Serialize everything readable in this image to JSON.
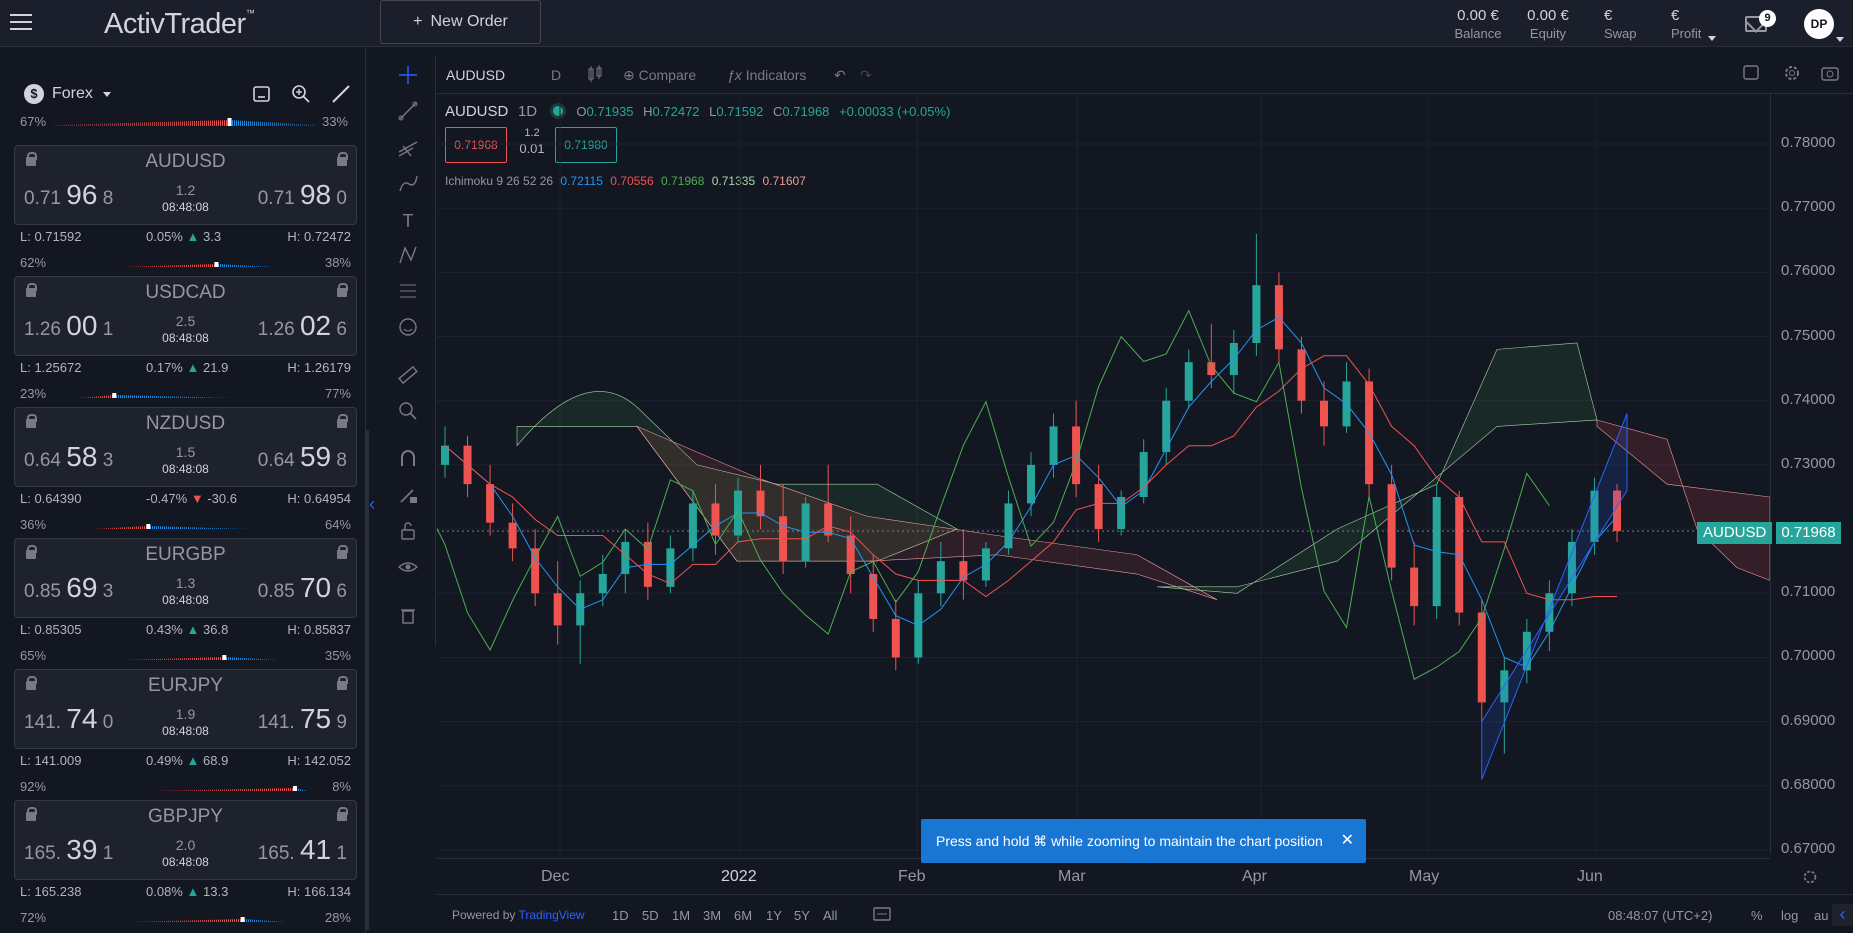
{
  "app": {
    "logo": "ActivTrader",
    "logo_mark": "™",
    "new_order": "New Order",
    "new_order_icon": "plus-icon"
  },
  "account": [
    {
      "value": "0.00 €",
      "label": "Balance"
    },
    {
      "value": "0.00 €",
      "label": "Equity"
    },
    {
      "value": "€",
      "label": "Swap"
    },
    {
      "value": "€",
      "label": "Profit"
    }
  ],
  "mail_count": "9",
  "user_initials": "DP",
  "sidebar": {
    "category": "Forex",
    "coin": "$",
    "prev_sentiment": {
      "sell": "67%",
      "buy": "33%"
    },
    "instruments": [
      {
        "symbol": "AUDUSD",
        "bid_a": "0.71",
        "bid_b": "96",
        "bid_c": "8",
        "ask_a": "0.71",
        "ask_b": "98",
        "ask_c": "0",
        "spread": "1.2",
        "time": "08:48:08",
        "low": "L: 0.71592",
        "change": "0.05%",
        "points": "3.3",
        "dir": "up",
        "high": "H: 0.72472",
        "sell": "62%",
        "buy": "38%",
        "sell_frac": 0.62
      },
      {
        "symbol": "USDCAD",
        "bid_a": "1.26",
        "bid_b": "00",
        "bid_c": "1",
        "ask_a": "1.26",
        "ask_b": "02",
        "ask_c": "6",
        "spread": "2.5",
        "time": "08:48:08",
        "low": "L: 1.25672",
        "change": "0.17%",
        "points": "21.9",
        "dir": "up",
        "high": "H: 1.26179",
        "sell": "23%",
        "buy": "77%",
        "sell_frac": 0.23
      },
      {
        "symbol": "NZDUSD",
        "bid_a": "0.64",
        "bid_b": "58",
        "bid_c": "3",
        "ask_a": "0.64",
        "ask_b": "59",
        "ask_c": "8",
        "spread": "1.5",
        "time": "08:48:08",
        "low": "L: 0.64390",
        "change": "-0.47%",
        "points": "-30.6",
        "dir": "down",
        "high": "H: 0.64954",
        "sell": "36%",
        "buy": "64%",
        "sell_frac": 0.36
      },
      {
        "symbol": "EURGBP",
        "bid_a": "0.85",
        "bid_b": "69",
        "bid_c": "3",
        "ask_a": "0.85",
        "ask_b": "70",
        "ask_c": "6",
        "spread": "1.3",
        "time": "08:48:08",
        "low": "L: 0.85305",
        "change": "0.43%",
        "points": "36.8",
        "dir": "up",
        "high": "H: 0.85837",
        "sell": "65%",
        "buy": "35%",
        "sell_frac": 0.65
      },
      {
        "symbol": "EURJPY",
        "bid_a": "141.",
        "bid_b": "74",
        "bid_c": "0",
        "ask_a": "141.",
        "ask_b": "75",
        "ask_c": "9",
        "spread": "1.9",
        "time": "08:48:08",
        "low": "L: 141.009",
        "change": "0.49%",
        "points": "68.9",
        "dir": "up",
        "high": "H: 142.052",
        "sell": "92%",
        "buy": "8%",
        "sell_frac": 0.92
      },
      {
        "symbol": "GBPJPY",
        "bid_a": "165.",
        "bid_b": "39",
        "bid_c": "1",
        "ask_a": "165.",
        "ask_b": "41",
        "ask_c": "1",
        "spread": "2.0",
        "time": "08:48:08",
        "low": "L: 165.238",
        "change": "0.08%",
        "points": "13.3",
        "dir": "up",
        "high": "H: 166.134",
        "sell": "72%",
        "buy": "28%",
        "sell_frac": 0.72
      }
    ]
  },
  "chart_toolbar": {
    "symbol": "AUDUSD",
    "interval": "D",
    "compare": "Compare",
    "indicators": "Indicators"
  },
  "chart_legend": {
    "symbol": "AUDUSD",
    "interval": "1D",
    "o_label": "O",
    "o": "0.71935",
    "h_label": "H",
    "h": "0.72472",
    "l_label": "L",
    "l": "0.71592",
    "c_label": "C",
    "c": "0.71968",
    "change": "+0.00033 (+0.05%)",
    "sell_box": "0.71968",
    "buy_box": "0.71980",
    "spread_top": "1.2",
    "spread_bottom": "0.01"
  },
  "ichimoku": {
    "label": "Ichimoku 9 26 52 26",
    "v1": "0.72115",
    "v2": "0.70556",
    "v3": "0.71968",
    "v4": "0.71335",
    "v5": "0.71607"
  },
  "colors": {
    "up": "#26a69a",
    "down": "#ef5350",
    "accent": "#2962ff",
    "toast": "#1976d2"
  },
  "chart_data": {
    "type": "candlestick",
    "symbol": "AUDUSD",
    "price_ticks": [
      "0.78000",
      "0.77000",
      "0.76000",
      "0.75000",
      "0.74000",
      "0.73000",
      "0.72000",
      "0.71000",
      "0.70000",
      "0.69000",
      "0.68000",
      "0.67000"
    ],
    "ylim": [
      0.67,
      0.78
    ],
    "time_ticks": [
      "Dec",
      "2022",
      "Feb",
      "Mar",
      "Apr",
      "May",
      "Jun"
    ],
    "current_price_label": "AUDUSD",
    "current_price": "0.71968",
    "ohlc": [
      [
        0.73,
        0.736,
        0.728,
        0.733
      ],
      [
        0.733,
        0.7345,
        0.725,
        0.727
      ],
      [
        0.727,
        0.73,
        0.719,
        0.721
      ],
      [
        0.721,
        0.724,
        0.715,
        0.717
      ],
      [
        0.717,
        0.72,
        0.708,
        0.71
      ],
      [
        0.71,
        0.715,
        0.702,
        0.705
      ],
      [
        0.705,
        0.712,
        0.699,
        0.71
      ],
      [
        0.71,
        0.716,
        0.708,
        0.713
      ],
      [
        0.713,
        0.72,
        0.71,
        0.718
      ],
      [
        0.718,
        0.721,
        0.709,
        0.711
      ],
      [
        0.711,
        0.719,
        0.71,
        0.717
      ],
      [
        0.717,
        0.726,
        0.715,
        0.724
      ],
      [
        0.724,
        0.727,
        0.716,
        0.719
      ],
      [
        0.719,
        0.728,
        0.718,
        0.726
      ],
      [
        0.726,
        0.73,
        0.72,
        0.722
      ],
      [
        0.722,
        0.727,
        0.713,
        0.715
      ],
      [
        0.715,
        0.725,
        0.714,
        0.724
      ],
      [
        0.724,
        0.73,
        0.718,
        0.719
      ],
      [
        0.719,
        0.722,
        0.71,
        0.713
      ],
      [
        0.713,
        0.716,
        0.704,
        0.706
      ],
      [
        0.706,
        0.709,
        0.698,
        0.7
      ],
      [
        0.7,
        0.712,
        0.699,
        0.71
      ],
      [
        0.71,
        0.718,
        0.708,
        0.715
      ],
      [
        0.715,
        0.72,
        0.709,
        0.712
      ],
      [
        0.712,
        0.718,
        0.711,
        0.717
      ],
      [
        0.717,
        0.726,
        0.716,
        0.724
      ],
      [
        0.724,
        0.732,
        0.722,
        0.73
      ],
      [
        0.73,
        0.738,
        0.728,
        0.736
      ],
      [
        0.736,
        0.74,
        0.725,
        0.727
      ],
      [
        0.727,
        0.73,
        0.718,
        0.72
      ],
      [
        0.72,
        0.726,
        0.719,
        0.725
      ],
      [
        0.725,
        0.734,
        0.724,
        0.732
      ],
      [
        0.732,
        0.742,
        0.73,
        0.74
      ],
      [
        0.74,
        0.748,
        0.739,
        0.746
      ],
      [
        0.746,
        0.752,
        0.742,
        0.744
      ],
      [
        0.744,
        0.751,
        0.741,
        0.749
      ],
      [
        0.749,
        0.766,
        0.747,
        0.758
      ],
      [
        0.758,
        0.76,
        0.746,
        0.748
      ],
      [
        0.748,
        0.75,
        0.738,
        0.74
      ],
      [
        0.74,
        0.743,
        0.733,
        0.736
      ],
      [
        0.736,
        0.746,
        0.735,
        0.743
      ],
      [
        0.743,
        0.745,
        0.725,
        0.727
      ],
      [
        0.727,
        0.73,
        0.712,
        0.714
      ],
      [
        0.714,
        0.718,
        0.705,
        0.708
      ],
      [
        0.708,
        0.727,
        0.706,
        0.725
      ],
      [
        0.725,
        0.726,
        0.705,
        0.707
      ],
      [
        0.707,
        0.709,
        0.69,
        0.693
      ],
      [
        0.693,
        0.7,
        0.685,
        0.698
      ],
      [
        0.698,
        0.706,
        0.696,
        0.704
      ],
      [
        0.704,
        0.712,
        0.701,
        0.71
      ],
      [
        0.71,
        0.72,
        0.708,
        0.718
      ],
      [
        0.718,
        0.728,
        0.716,
        0.726
      ],
      [
        0.726,
        0.727,
        0.718,
        0.7197
      ]
    ]
  },
  "bottom_bar": {
    "powered_by": "Powered by",
    "provider": "TradingView",
    "ranges": [
      "1D",
      "5D",
      "1M",
      "3M",
      "6M",
      "1Y",
      "5Y",
      "All"
    ],
    "clock": "08:48:07 (UTC+2)",
    "pct": "%",
    "log": "log",
    "auto": "au"
  },
  "toast": {
    "text": "Press and hold ⌘ while zooming to maintain the chart position"
  }
}
